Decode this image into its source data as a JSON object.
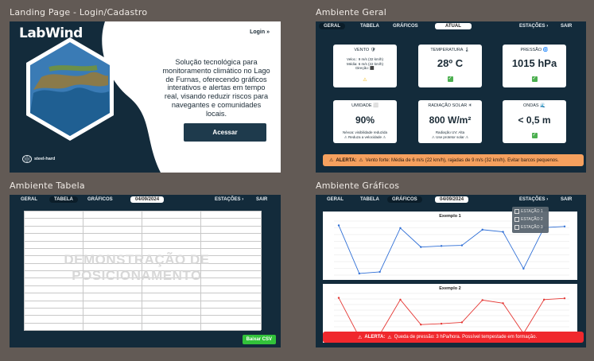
{
  "captions": {
    "landing": "Landing Page - Login/Cadastro",
    "geral": "Ambiente Geral",
    "tabela": "Ambiente Tabela",
    "graficos": "Ambiente Gráficos"
  },
  "landing": {
    "logo": "LabWind",
    "login": "Login »",
    "description": "Solução tecnológica para monitoramento climático no Lago de Furnas, oferecendo gráficos interativos e alertas em tempo real, visando reduzir riscos para navegantes e comunidades locais.",
    "button": "Acessar",
    "brand": "steel-hard"
  },
  "geral": {
    "nav": {
      "geral": "GERAL",
      "tabela": "TABELA",
      "graficos": "GRÁFICOS",
      "atual": "ATUAL",
      "estacoes": "ESTAÇÕES ›",
      "sair": "SAIR"
    },
    "cards": {
      "vento": {
        "title": "VENTO 🛡",
        "line1": "Veloc.: 9 m/s (32 km/h)",
        "line2": "Média: 6 m/s (22 km/h)",
        "line3": "Direção: ⬛"
      },
      "temperatura": {
        "title": "TEMPERATURA 🌡",
        "value": "28º C"
      },
      "pressao": {
        "title": "PRESSÃO 🌀",
        "value": "1015 hPa"
      },
      "umidade": {
        "title": "UMIDADE ⬜",
        "value": "90%",
        "line1": "Névoa: visibilidade reduzida",
        "line2": "⚠ Reduza a velocidade ⚠"
      },
      "radiacao": {
        "title": "RADIAÇÃO SOLAR ☀",
        "value": "800 W/m²",
        "line1": "Radiação UV: Alta",
        "line2": "⚠ Use protetor solar ⚠"
      },
      "ondas": {
        "title": "ONDAS 🌊",
        "value": "< 0,5 m"
      }
    },
    "alert": {
      "label": "ALERTA:",
      "text": "Vento forte: Média de 6 m/s (22 km/h), rajadas de 9 m/s (32 km/h). Evitar barcos pequenos."
    }
  },
  "tabela": {
    "nav": {
      "geral": "GERAL",
      "tabela": "TABELA",
      "graficos": "GRÁFICOS",
      "date": "04/09/2024",
      "estacoes": "ESTAÇÕES ›",
      "sair": "SAIR"
    },
    "watermark": "DEMONSTRAÇÃO DE POSICIONAMENTO",
    "csv": "Baixar CSV"
  },
  "graficos": {
    "nav": {
      "geral": "GERAL",
      "tabela": "TABELA",
      "graficos": "GRÁFICOS",
      "date": "04/09/2024",
      "estacoes": "ESTAÇÕES ›",
      "sair": "SAIR"
    },
    "dropdown": [
      "ESTAÇÃO 1",
      "ESTAÇÃO 2",
      "ESTAÇÃO 3"
    ],
    "alert": {
      "label": "ALERTA:",
      "text": "Queda de pressão: 3 hPa/hora. Possível tempestade em formação."
    }
  },
  "chart_data": [
    {
      "type": "line",
      "title": "Exemplo 1",
      "color": "#2f6fd6",
      "x": [
        1,
        2,
        3,
        4,
        5,
        6,
        7,
        8,
        9,
        10,
        11,
        12
      ],
      "values": [
        9.2,
        0.3,
        0.6,
        8.7,
        5.2,
        5.4,
        5.5,
        8.4,
        8.0,
        1.2,
        8.8,
        9.0
      ],
      "ylim": [
        0,
        10
      ]
    },
    {
      "type": "line",
      "title": "Exemplo 2",
      "color": "#e53935",
      "x": [
        1,
        2,
        3,
        4,
        5,
        6,
        7,
        8,
        9,
        10,
        11,
        12
      ],
      "values": [
        9.0,
        0.2,
        0.8,
        8.6,
        3.0,
        3.2,
        3.5,
        8.5,
        7.8,
        1.0,
        8.6,
        8.9
      ],
      "ylim": [
        0,
        10
      ]
    }
  ]
}
